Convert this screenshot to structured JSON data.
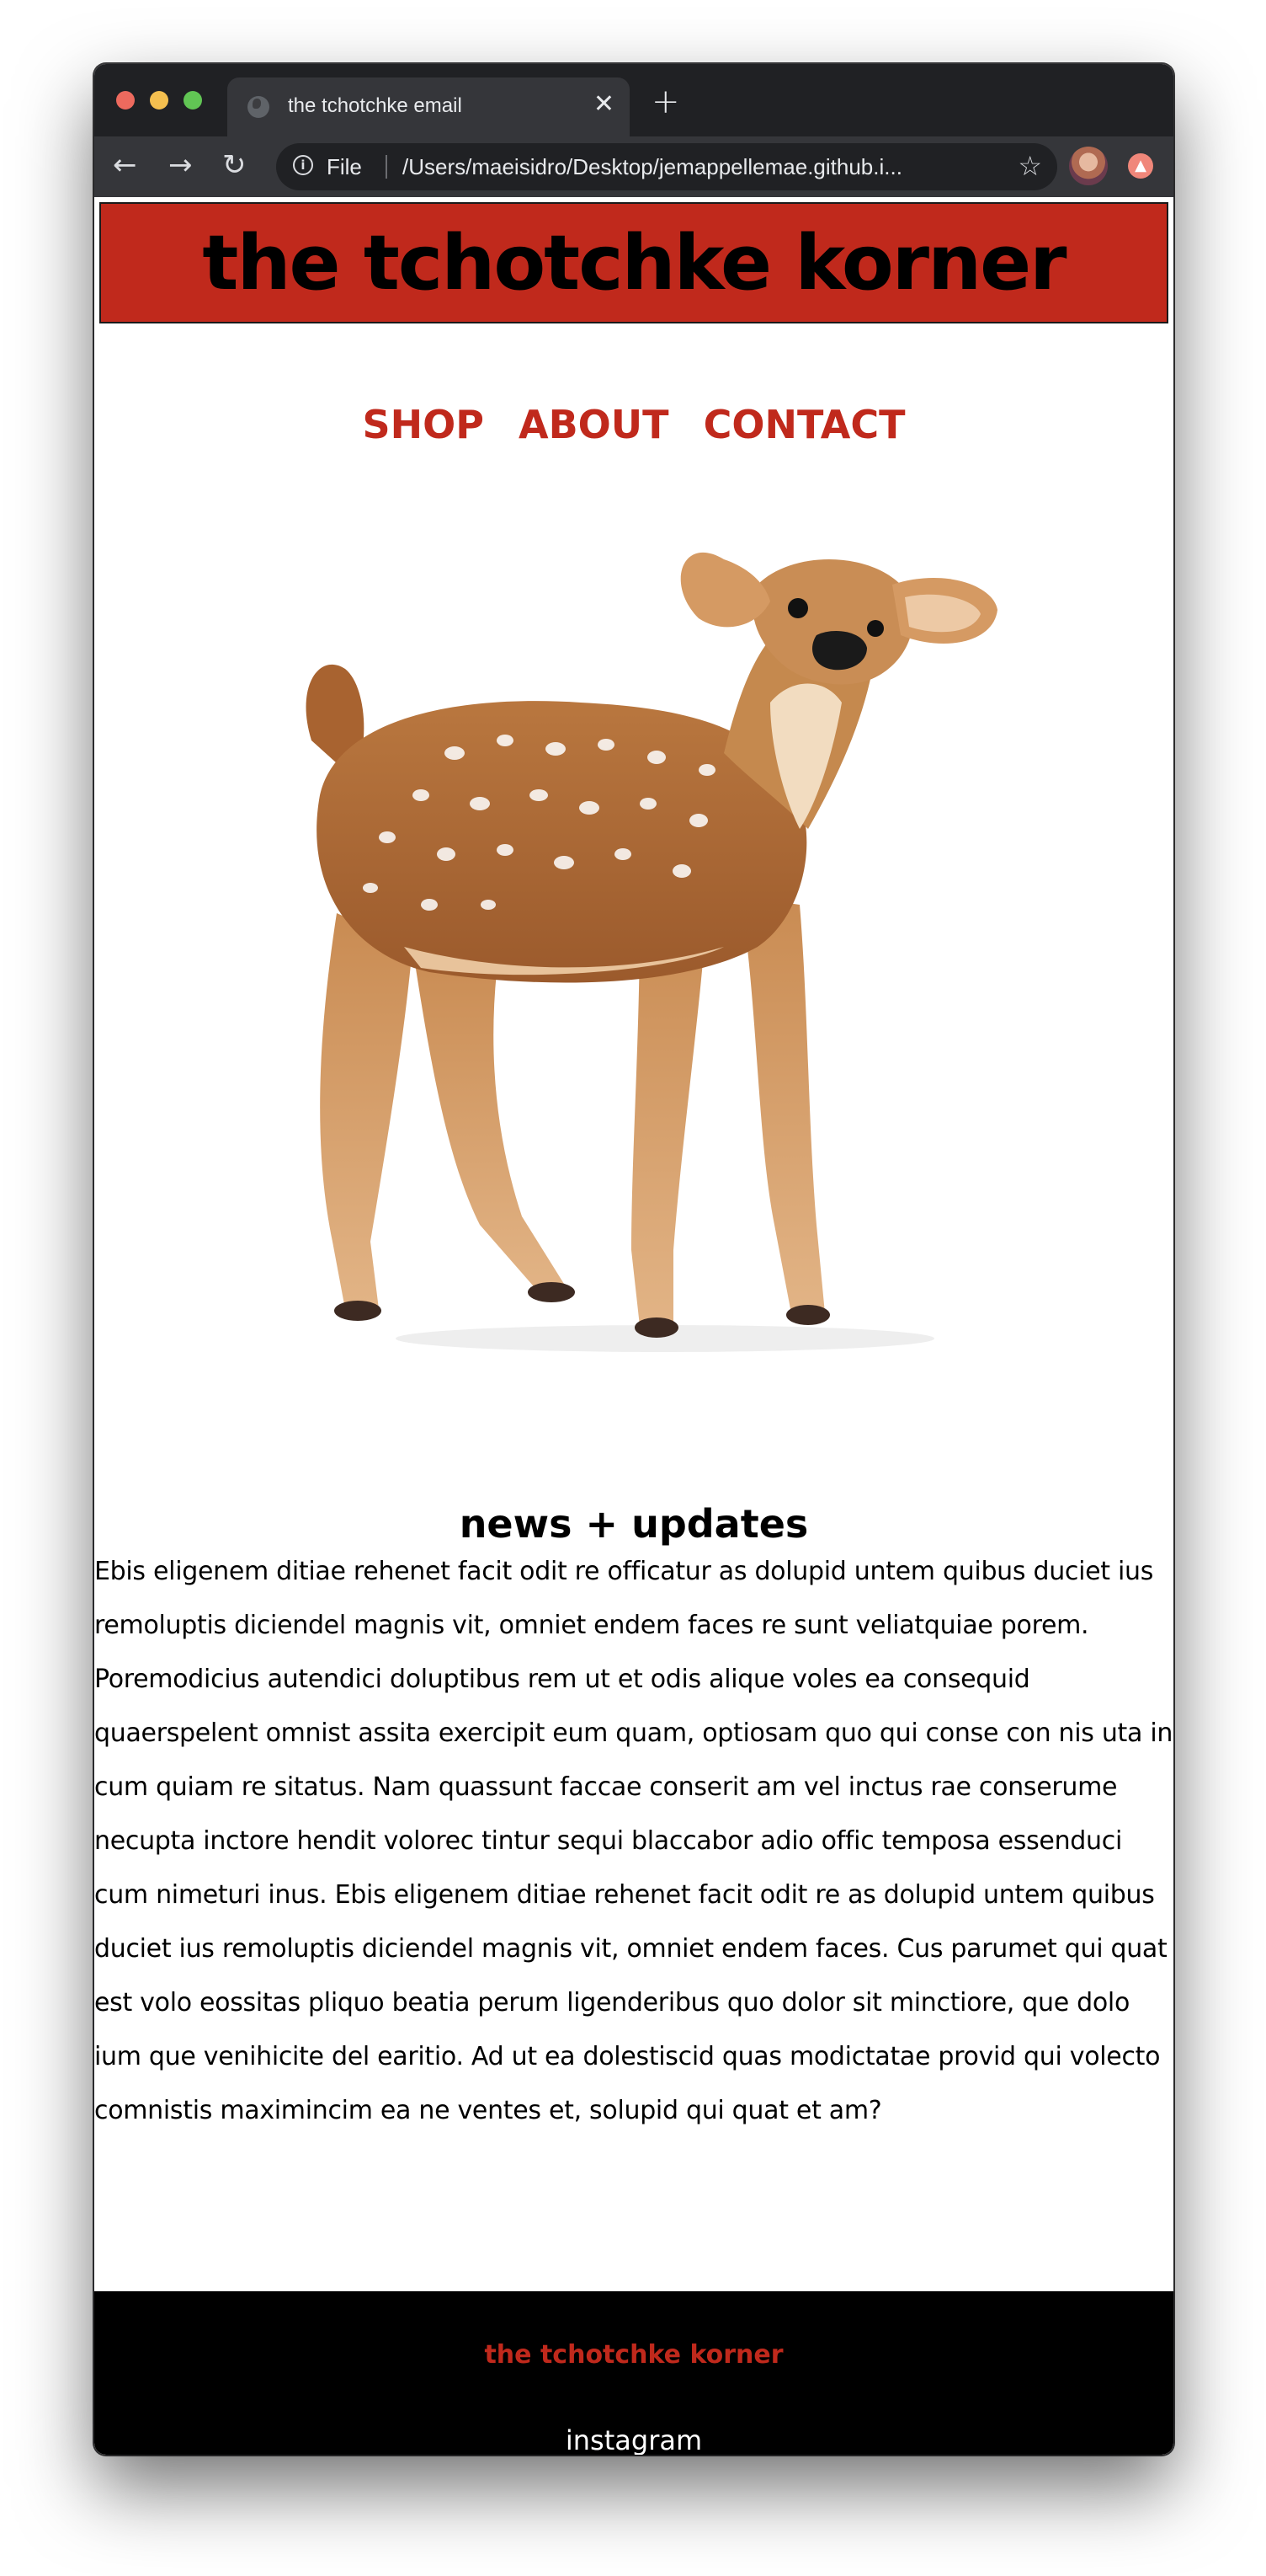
{
  "browser": {
    "tab_title": "the tchotchke email",
    "close_glyph": "✕",
    "new_tab_glyph": "+",
    "back_glyph": "←",
    "forward_glyph": "→",
    "reload_glyph": "↻",
    "info_glyph": "i",
    "scheme": "File",
    "url": "/Users/maeisidro/Desktop/jemappellemae.github.i...",
    "star_glyph": "☆",
    "ext_glyph": "▲",
    "traffic_lights": [
      "#ed6a5e",
      "#f4bf4f",
      "#61c554"
    ]
  },
  "site": {
    "title": "the tchotchke korner",
    "nav": [
      "SHOP",
      "ABOUT",
      "CONTACT"
    ],
    "hero_image": "fawn-figurine",
    "news_title": "news + updates",
    "news_body": "Ebis eligenem ditiae rehenet facit odit re officatur as dolupid untem quibus duciet ius remoluptis diciendel magnis vit, omniet endem faces re sunt veliatquiae porem. Poremodicius autendici doluptibus rem ut et odis alique voles ea consequid quaerspelent omnist assita exercipit eum quam, optiosam quo qui conse con nis uta in cum quiam re sitatus. Nam quassunt faccae conserit am vel inctus rae conserume necupta inctore hendit volorec tintur sequi blaccabor adio offic temposa essenduci cum nimeturi inus. Ebis eligenem ditiae rehenet facit odit re as dolupid untem quibus duciet ius remoluptis diciendel magnis vit, omniet endem faces. Cus parumet qui quat est volo eossitas pliquo beatia perum ligenderibus quo dolor sit minctiore, que dolo ium que venihicite del earitio. Ad ut ea dolestiscid quas modictatae provid qui volecto comnistis maximincim ea ne ventes et, solupid qui quat et am?",
    "footer_brand": "the tchotchke korner",
    "footer_link": "instagram"
  },
  "colors": {
    "brand_red": "#c0291c",
    "text": "#000000",
    "footer_bg": "#000000"
  }
}
